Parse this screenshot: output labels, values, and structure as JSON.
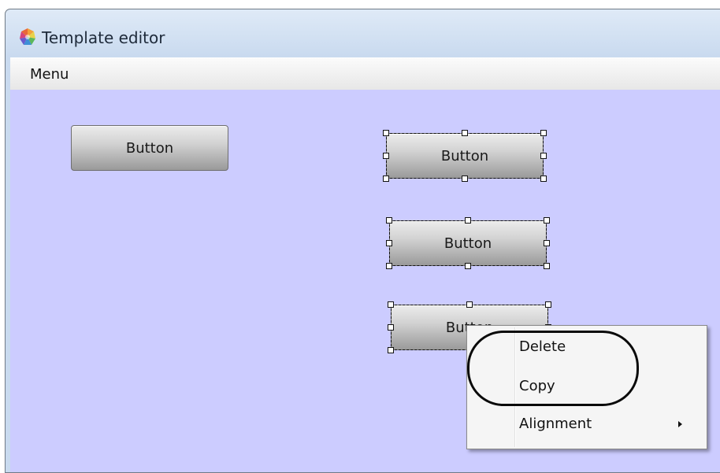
{
  "window": {
    "title": "Template editor"
  },
  "menubar": {
    "menu_label": "Menu"
  },
  "canvas": {
    "buttons": [
      {
        "label": "Button",
        "selected": false
      },
      {
        "label": "Button",
        "selected": true
      },
      {
        "label": "Button",
        "selected": true
      },
      {
        "label": "Button",
        "selected": true,
        "partially_covered": true
      }
    ]
  },
  "context_menu": {
    "items": [
      {
        "label": "Delete"
      },
      {
        "label": "Copy"
      },
      {
        "label": "Alignment",
        "has_submenu": true
      }
    ],
    "highlight": "circled items: Delete, Copy"
  },
  "colors": {
    "canvas_background": "#ccccff",
    "title_gradient": "#dfeaf7",
    "menu_background": "#f5f5f5"
  },
  "icons": {
    "app": "template-editor-icon",
    "submenu": "chevron-right-icon"
  }
}
